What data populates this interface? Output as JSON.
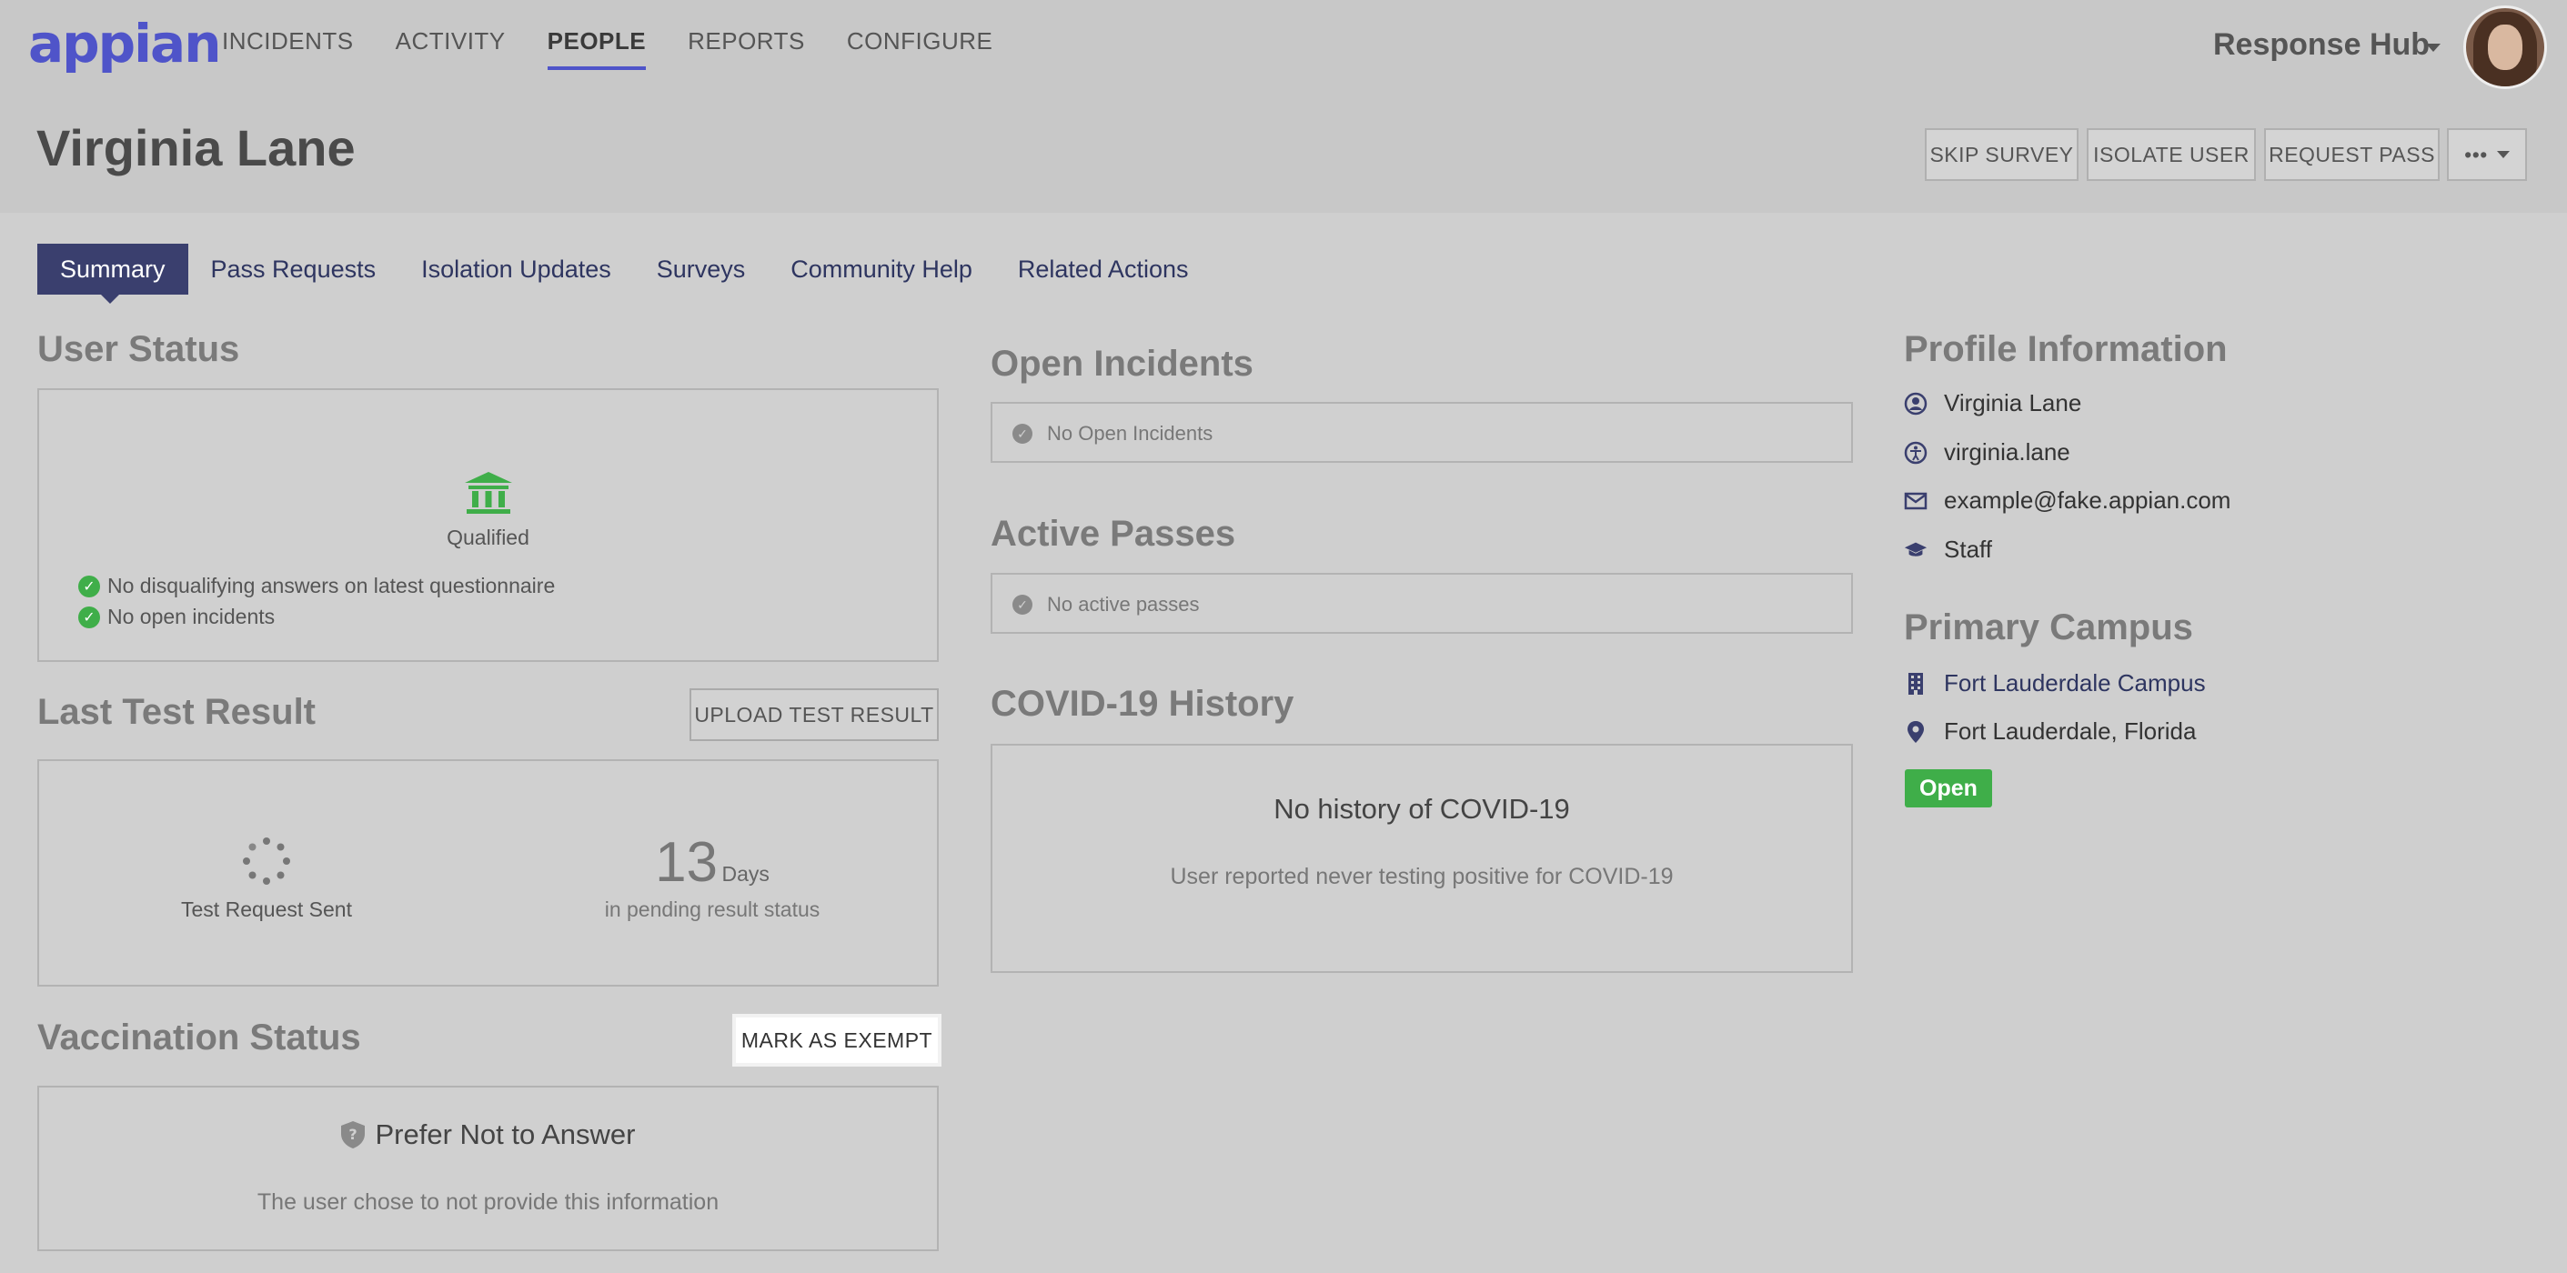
{
  "app": {
    "logo_text": "appian",
    "site_name": "Response Hub"
  },
  "nav": {
    "items": [
      {
        "label": "INCIDENTS"
      },
      {
        "label": "ACTIVITY"
      },
      {
        "label": "PEOPLE",
        "active": true
      },
      {
        "label": "REPORTS"
      },
      {
        "label": "CONFIGURE"
      }
    ]
  },
  "page": {
    "title": "Virginia Lane"
  },
  "actions": {
    "skip_survey": "SKIP SURVEY",
    "isolate_user": "ISOLATE USER",
    "request_pass": "REQUEST PASS",
    "more": "•••"
  },
  "tabs": [
    {
      "label": "Summary",
      "active": true
    },
    {
      "label": "Pass Requests"
    },
    {
      "label": "Isolation Updates"
    },
    {
      "label": "Surveys"
    },
    {
      "label": "Community Help"
    },
    {
      "label": "Related Actions"
    }
  ],
  "user_status": {
    "title": "User Status",
    "status": "Qualified",
    "checks": [
      "No disqualifying answers on latest questionnaire",
      "No open incidents"
    ]
  },
  "last_test": {
    "title": "Last Test Result",
    "upload_label": "UPLOAD TEST RESULT",
    "status": "Test Request Sent",
    "days_value": "13",
    "days_unit": "Days",
    "days_caption": "in pending result status"
  },
  "vaccination": {
    "title": "Vaccination Status",
    "exempt_label": "MARK AS EXEMPT",
    "answer": "Prefer Not to Answer",
    "description": "The user chose to not provide this information"
  },
  "open_incidents": {
    "title": "Open Incidents",
    "message": "No Open Incidents"
  },
  "active_passes": {
    "title": "Active Passes",
    "message": "No active passes"
  },
  "covid_history": {
    "title": "COVID-19 History",
    "heading": "No history of COVID-19",
    "description": "User reported never testing positive for COVID-19"
  },
  "profile": {
    "title": "Profile Information",
    "name": "Virginia Lane",
    "username": "virginia.lane",
    "email": "example@fake.appian.com",
    "role": "Staff"
  },
  "campus": {
    "title": "Primary Campus",
    "name": "Fort Lauderdale Campus",
    "location": "Fort Lauderdale, Florida",
    "status": "Open"
  },
  "colors": {
    "accent": "#4f54c9",
    "tab_active": "#3a3f6e",
    "success": "#3fae49"
  }
}
